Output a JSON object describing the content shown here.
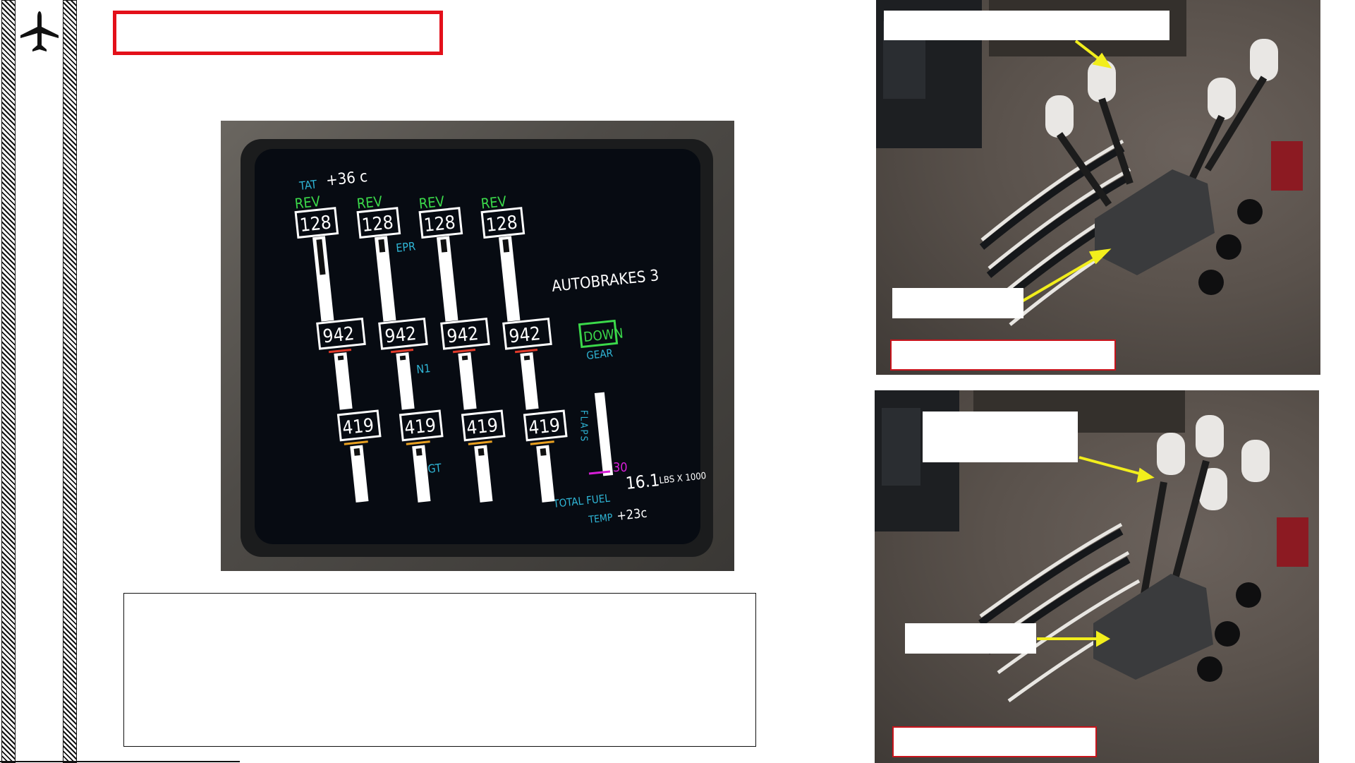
{
  "slide": {
    "title_box": "",
    "caption_box": ""
  },
  "eicas": {
    "tat_label": "TAT",
    "tat_value": "+36 c",
    "rev_labels": [
      "REV",
      "REV",
      "REV",
      "REV"
    ],
    "epr_values": [
      "128",
      "128",
      "128",
      "128"
    ],
    "epr_label": "EPR",
    "n1_values": [
      "942",
      "942",
      "942",
      "942"
    ],
    "n1_label": "N1",
    "egt_values": [
      "419",
      "419",
      "419",
      "419"
    ],
    "egt_label": "EGT",
    "autobrakes": "AUTOBRAKES 3",
    "gear_status": "DOWN",
    "gear_label": "GEAR",
    "flaps_label": "FLAPS",
    "flaps_value": "30",
    "total_fuel_label": "TOTAL FUEL",
    "fuel_value": "16.1",
    "fuel_units": "LBS X 1000",
    "temp_label": "TEMP",
    "temp_value": "+23c"
  },
  "colors": {
    "accent_red": "#e3101a",
    "eicas_green": "#3bd94a",
    "eicas_cyan": "#2fb6d6",
    "eicas_magenta": "#d81ed8",
    "arrow_yellow": "#f2ee1c"
  }
}
